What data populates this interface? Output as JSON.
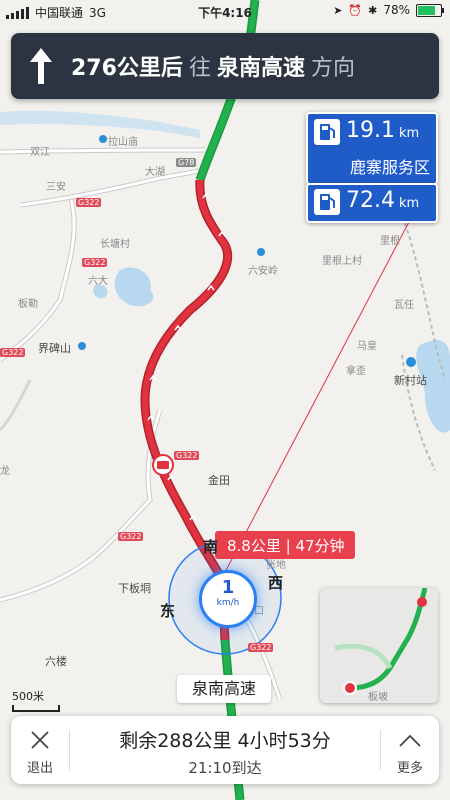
{
  "status_bar": {
    "carrier": "中国联通",
    "network": "3G",
    "time": "下午4:16",
    "battery": "78%"
  },
  "instruction": {
    "distance": "276公里后",
    "connector": "往",
    "road": "泉南高速",
    "direction": "方向"
  },
  "service_areas": [
    {
      "distance": "19.1",
      "unit": "km",
      "name": "鹿寨服务区"
    },
    {
      "distance": "72.4",
      "unit": "km"
    }
  ],
  "map_labels": {
    "lashanmiao": "拉山庙",
    "shuangjiang": "双江",
    "dahu": "大湖",
    "sanan": "三安",
    "changtang": "长塘村",
    "liuda": "六大",
    "banle": "板勒",
    "jiebeishan": "界碑山",
    "liuanling": "六安岭",
    "ligen": "里根",
    "ligenshang": "里根上村",
    "waren": "瓦任",
    "mahuang": "马皇",
    "najia": "拿歪",
    "xincunzhan": "新村站",
    "jintian": "金田",
    "xiabandong": "下板垌",
    "liulou": "六楼",
    "panlong": "龙",
    "zhangxi": "张地",
    "nankou": "南口",
    "banpo": "板坡"
  },
  "road_tags": [
    "G78",
    "G322",
    "G322",
    "G322",
    "G322",
    "G322",
    "G322"
  ],
  "route_bubble": "8.8公里 | 47分钟",
  "compass": {
    "south": "南",
    "east": "东",
    "west": "西"
  },
  "speed": {
    "value": "1",
    "unit": "km/h"
  },
  "current_road": "泉南高速",
  "scale": "500米",
  "bottom_bar": {
    "exit_label": "退出",
    "remaining": "剩余288公里 4小时53分",
    "arrival": "21:10到达",
    "more_label": "更多"
  },
  "colors": {
    "route_green": "#22b14c",
    "route_red": "#e0323f",
    "panel_dark": "#2b3440",
    "service_blue": "#1f5cc8",
    "bubble_red": "#e8414d"
  }
}
